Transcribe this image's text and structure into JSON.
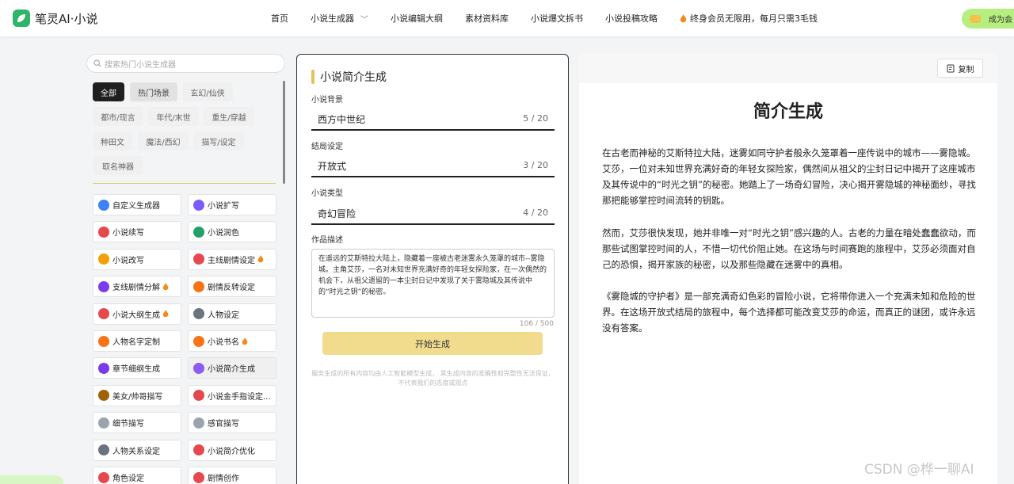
{
  "brand": {
    "name": "笔灵AI·小说",
    "color": "#2fb56a"
  },
  "nav": {
    "items": [
      "首页",
      "小说生成器",
      "小说编辑大纲",
      "素材资料库",
      "小说爆文拆书",
      "小说投稿攻略"
    ],
    "promo": "终身会员无限用，每月只需3毛钱",
    "vip": "成为会"
  },
  "sidebar": {
    "search_placeholder": "搜索热门小说生成器",
    "categories": [
      "全部",
      "热门场景",
      "玄幻/仙侠",
      "都市/现言",
      "年代/末世",
      "重生/穿越",
      "种田文",
      "魔法/西幻",
      "描写/设定",
      "取名神器"
    ],
    "tools": [
      {
        "label": "自定义生成器",
        "icon": "custom-icon",
        "hot": false
      },
      {
        "label": "小说扩写",
        "icon": "expand-icon",
        "hot": false
      },
      {
        "label": "小说续写",
        "icon": "continue-icon",
        "hot": false
      },
      {
        "label": "小说润色",
        "icon": "polish-icon",
        "hot": false
      },
      {
        "label": "小说改写",
        "icon": "rewrite-icon",
        "hot": false
      },
      {
        "label": "主线剧情设定",
        "icon": "plot-icon",
        "hot": true
      },
      {
        "label": "支线剧情分解",
        "icon": "branch-icon",
        "hot": true
      },
      {
        "label": "剧情反转设定",
        "icon": "twist-icon",
        "hot": false
      },
      {
        "label": "小说大纲生成",
        "icon": "outline-icon",
        "hot": true
      },
      {
        "label": "人物设定",
        "icon": "character-icon",
        "hot": false
      },
      {
        "label": "人物名字定制",
        "icon": "name-icon",
        "hot": false
      },
      {
        "label": "小说书名",
        "icon": "title-icon",
        "hot": true
      },
      {
        "label": "章节细纲生成",
        "icon": "chapter-icon",
        "hot": false
      },
      {
        "label": "小说简介生成",
        "icon": "summary-icon",
        "hot": false
      },
      {
        "label": "美女/帅哥描写",
        "icon": "portrait-icon",
        "hot": false
      },
      {
        "label": "小说金手指设定...",
        "icon": "cheat-icon",
        "hot": false
      },
      {
        "label": "细节描写",
        "icon": "detail-icon",
        "hot": false
      },
      {
        "label": "感官描写",
        "icon": "senses-icon",
        "hot": false
      },
      {
        "label": "人物关系设定",
        "icon": "relation-icon",
        "hot": false
      },
      {
        "label": "小说简介优化",
        "icon": "optimize-icon",
        "hot": false
      },
      {
        "label": "角色设定",
        "icon": "role-icon",
        "hot": false
      },
      {
        "label": "剧情创作",
        "icon": "story-icon",
        "hot": false
      }
    ]
  },
  "form": {
    "title": "小说简介生成",
    "fields": [
      {
        "label": "小说背景",
        "value": "西方中世纪",
        "count": "5 / 20"
      },
      {
        "label": "结局设定",
        "value": "开放式",
        "count": "3 / 20"
      },
      {
        "label": "小说类型",
        "value": "奇幻冒险",
        "count": "4 / 20"
      }
    ],
    "desc_label": "作品描述",
    "desc_value": "在遥远的艾斯特拉大陆上，隐藏着一座被古老迷雾永久笼罩的城市--雾隐城。主角艾莎，一名对未知世界充满好奇的年轻女探险家，在一次偶然的机会下，从祖父遗留的一本尘封日记中发现了关于雾隐城及其传说中的“时光之钥”的秘密。",
    "desc_count": "106 / 500",
    "button": "开始生成",
    "disclaimer": "服务生成的所有内容均由人工智能模型生成， 其生成内容的准确性和完整性无法保证， 不代表我们的态度或观点"
  },
  "output": {
    "copy": "复制",
    "title": "简介生成",
    "paragraphs": [
      "在古老而神秘的艾斯特拉大陆，迷雾如同守护者般永久笼罩着一座传说中的城市——雾隐城。艾莎，一位对未知世界充满好奇的年轻女探险家，偶然间从祖父的尘封日记中揭开了这座城市及其传说中的“时光之钥”的秘密。她踏上了一场奇幻冒险，决心揭开雾隐城的神秘面纱，寻找那把能够掌控时间流转的钥匙。",
      "然而，艾莎很快发现，她并非唯一对“时光之钥”感兴趣的人。古老的力量在暗处蠢蠢欲动，而那些试图掌控时间的人，不惜一切代价阻止她。在这场与时间赛跑的旅程中，艾莎必须面对自己的恐惧，揭开家族的秘密，以及那些隐藏在迷雾中的真相。",
      "《雾隐城的守护者》是一部充满奇幻色彩的冒险小说，它将带你进入一个充满未知和危险的世界。在这场开放式结局的旅程中，每个选择都可能改变艾莎的命运，而真正的谜团，或许永远没有答案。"
    ]
  },
  "watermark": "CSDN @桦一聊AI"
}
